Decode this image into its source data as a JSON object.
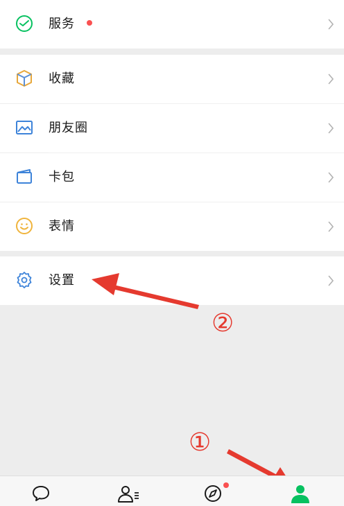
{
  "menu": {
    "service": {
      "label": "服务",
      "icon": "wechat-pay-icon"
    },
    "favorites": {
      "label": "收藏",
      "icon": "cube-icon"
    },
    "moments": {
      "label": "朋友圈",
      "icon": "image-icon"
    },
    "cards": {
      "label": "卡包",
      "icon": "card-wallet-icon"
    },
    "stickers": {
      "label": "表情",
      "icon": "smiley-icon"
    },
    "settings": {
      "label": "设置",
      "icon": "gear-icon"
    }
  },
  "tabbar": {
    "items": [
      {
        "icon": "chat-bubble-icon",
        "active": false
      },
      {
        "icon": "contacts-icon",
        "active": false
      },
      {
        "icon": "discover-compass-icon",
        "active": false,
        "badge": true
      },
      {
        "icon": "me-person-icon",
        "active": true
      }
    ]
  },
  "annotations": {
    "marker_1": "①",
    "marker_2": "②"
  },
  "colors": {
    "accent_green": "#07c160",
    "badge_red": "#fa5151",
    "annotation_red": "#e53a2f",
    "background": "#ededed"
  }
}
